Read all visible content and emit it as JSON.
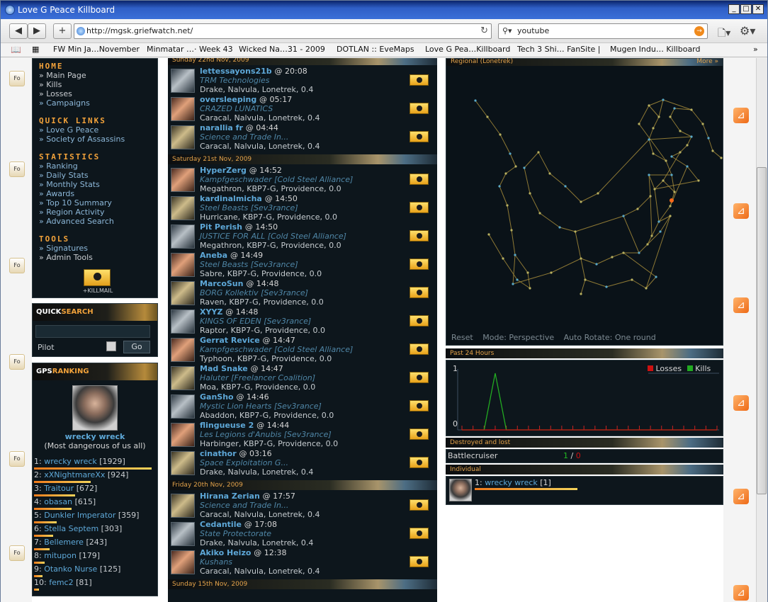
{
  "window": {
    "title": "Love G Peace Killboard"
  },
  "browser": {
    "url": "http://mgsk.griefwatch.net/",
    "search_value": "youtube",
    "bookmarks": [
      "FW Min Ja…November",
      "Minmatar …· Week 43",
      "Wicked Na…31 - 2009",
      "DOTLAN :: EveMaps",
      "Love G Pea…Killboard",
      "Tech 3 Shi… FanSite |",
      "Mugen Indu… Killboard"
    ]
  },
  "nav": {
    "home_title": "HOME",
    "home_links": [
      "Main Page",
      "Kills",
      "Losses",
      "Campaigns"
    ],
    "quick_title": "QUICK LINKS",
    "quick_links": [
      "Love G Peace",
      "Society of Assassins"
    ],
    "stats_title": "STATISTICS",
    "stats_links": [
      "Ranking",
      "Daily Stats",
      "Monthly Stats",
      "Awards",
      "Top 10 Summary",
      "Region Activity",
      "Advanced Search"
    ],
    "tools_title": "TOOLS",
    "tools_links": [
      "Signatures",
      "Admin Tools"
    ],
    "killmail_label": "+KILLMAIL"
  },
  "quicksearch": {
    "title_a": "QUICK",
    "title_b": "SEARCH",
    "field_label": "Pilot",
    "go": "Go"
  },
  "gpsranking": {
    "title_a": "GPS",
    "title_b": "RANKING",
    "top_name": "wrecky wreck",
    "top_sub": "(Most dangerous of us all)",
    "rows": [
      {
        "rank": "1:",
        "name": "wrecky wreck",
        "score": "[1929]",
        "bar": 1.0
      },
      {
        "rank": "2:",
        "name": "xXNightmareXx",
        "score": "[924]",
        "bar": 0.48
      },
      {
        "rank": "3:",
        "name": "Traitour",
        "score": "[672]",
        "bar": 0.35
      },
      {
        "rank": "4:",
        "name": "obasan",
        "score": "[615]",
        "bar": 0.32
      },
      {
        "rank": "5:",
        "name": "Dunkler Imperator",
        "score": "[359]",
        "bar": 0.19
      },
      {
        "rank": "6:",
        "name": "Stella Septem",
        "score": "[303]",
        "bar": 0.16
      },
      {
        "rank": "7:",
        "name": "Bellemere",
        "score": "[243]",
        "bar": 0.13
      },
      {
        "rank": "8:",
        "name": "mitupon",
        "score": "[179]",
        "bar": 0.09
      },
      {
        "rank": "9:",
        "name": "Otanko Nurse",
        "score": "[125]",
        "bar": 0.07
      },
      {
        "rank": "10:",
        "name": "femc2",
        "score": "[81]",
        "bar": 0.04
      }
    ]
  },
  "days": [
    {
      "label": "Sunday 22nd Nov, 2009",
      "kills": [
        {
          "pilot": "lettessayons21b",
          "time": "@ 20:08",
          "corp": "TRM Technologies",
          "alliance": "",
          "loc": "Drake, Nalvula, Lonetrek, 0.4"
        },
        {
          "pilot": "oversleeping",
          "time": "@ 05:17",
          "corp": "CRAZED LUNATICS",
          "alliance": "",
          "loc": "Caracal, Nalvula, Lonetrek, 0.4"
        },
        {
          "pilot": "narallia fr",
          "time": "@ 04:44",
          "corp": "Science and Trade In...",
          "alliance": "",
          "loc": "Caracal, Nalvula, Lonetrek, 0.4"
        }
      ]
    },
    {
      "label": "Saturday 21st Nov, 2009",
      "kills": [
        {
          "pilot": "HyperZerg",
          "time": "@ 14:52",
          "corp": "Kampfgeschwader",
          "alliance": "[Cold Steel Alliance]",
          "loc": "Megathron, KBP7-G, Providence, 0.0"
        },
        {
          "pilot": "kardinalmicha",
          "time": "@ 14:50",
          "corp": "Steel Beasts",
          "alliance": "[Sev3rance]",
          "loc": "Hurricane, KBP7-G, Providence, 0.0"
        },
        {
          "pilot": "Pit Perish",
          "time": "@ 14:50",
          "corp": "JUSTICE FOR ALL",
          "alliance": "[Cold Steel Alliance]",
          "loc": "Megathron, KBP7-G, Providence, 0.0"
        },
        {
          "pilot": "Aneba",
          "time": "@ 14:49",
          "corp": "Steel Beasts",
          "alliance": "[Sev3rance]",
          "loc": "Sabre, KBP7-G, Providence, 0.0"
        },
        {
          "pilot": "MarcoSun",
          "time": "@ 14:48",
          "corp": "BORG Kollektiv",
          "alliance": "[Sev3rance]",
          "loc": "Raven, KBP7-G, Providence, 0.0"
        },
        {
          "pilot": "XYYZ",
          "time": "@ 14:48",
          "corp": "KINGS OF EDEN",
          "alliance": "[Sev3rance]",
          "loc": "Raptor, KBP7-G, Providence, 0.0"
        },
        {
          "pilot": "Gerrat Revice",
          "time": "@ 14:47",
          "corp": "Kampfgeschwader",
          "alliance": "[Cold Steel Alliance]",
          "loc": "Typhoon, KBP7-G, Providence, 0.0"
        },
        {
          "pilot": "Mad Snake",
          "time": "@ 14:47",
          "corp": "Haluter",
          "alliance": "[Freelancer Coalition]",
          "loc": "Moa, KBP7-G, Providence, 0.0"
        },
        {
          "pilot": "GanSho",
          "time": "@ 14:46",
          "corp": "Mystic Lion Hearts",
          "alliance": "[Sev3rance]",
          "loc": "Abaddon, KBP7-G, Providence, 0.0"
        },
        {
          "pilot": "flingueuse 2",
          "time": "@ 14:44",
          "corp": "Les Legions d'Anubis",
          "alliance": "[Sev3rance]",
          "loc": "Harbinger, KBP7-G, Providence, 0.0"
        },
        {
          "pilot": "cinathor",
          "time": "@ 03:16",
          "corp": "Space Exploitation G...",
          "alliance": "",
          "loc": "Drake, Nalvula, Lonetrek, 0.4"
        }
      ]
    },
    {
      "label": "Friday 20th Nov, 2009",
      "kills": [
        {
          "pilot": "Hirana Zerian",
          "time": "@ 17:57",
          "corp": "Science and Trade In...",
          "alliance": "",
          "loc": "Caracal, Nalvula, Lonetrek, 0.4"
        },
        {
          "pilot": "Cedantile",
          "time": "@ 17:08",
          "corp": "State Protectorate",
          "alliance": "",
          "loc": "Drake, Nalvula, Lonetrek, 0.4"
        },
        {
          "pilot": "Akiko Heizo",
          "time": "@ 12:38",
          "corp": "Kushans",
          "alliance": "",
          "loc": "Caracal, Nalvula, Lonetrek, 0.4"
        }
      ]
    },
    {
      "label": "Sunday 15th Nov, 2009",
      "kills": []
    }
  ],
  "map": {
    "header": "Regional (Lonetrek)",
    "more": "More »",
    "controls": [
      "Reset",
      "Mode: Perspective",
      "Auto Rotate: One round"
    ]
  },
  "past24": {
    "header": "Past 24 Hours",
    "legend_losses": "Losses",
    "legend_kills": "Kills",
    "y_max_label": "1",
    "y_min_label": "0",
    "colors": {
      "losses": "#cc1111",
      "kills": "#22aa22"
    }
  },
  "chart_data": {
    "type": "line",
    "title": "Past 24 Hours",
    "xlabel": "",
    "ylabel": "",
    "ylim": [
      0,
      1
    ],
    "x": [
      0,
      1,
      2,
      3,
      4,
      5,
      6,
      7,
      8,
      9,
      10,
      11,
      12,
      13,
      14,
      15,
      16,
      17,
      18,
      19,
      20,
      21,
      22,
      23
    ],
    "series": [
      {
        "name": "Kills",
        "values": [
          0,
          0,
          0,
          1,
          0,
          0,
          0,
          0,
          0,
          0,
          0,
          0,
          0,
          0,
          0,
          0,
          0,
          0,
          0,
          0,
          0,
          0,
          0,
          0
        ]
      },
      {
        "name": "Losses",
        "values": [
          0,
          0,
          0,
          0,
          0,
          0,
          0,
          0,
          0,
          0,
          0,
          0,
          0,
          0,
          0,
          0,
          0,
          0,
          0,
          0,
          0,
          0,
          0,
          0
        ]
      }
    ]
  },
  "destroyed": {
    "header": "Destroyed and lost",
    "class": "Battlecruiser",
    "kills": "1",
    "sep": "/",
    "losses": "0"
  },
  "individual": {
    "header": "Individual",
    "rank": "1:",
    "name": "wrecky wreck",
    "score": "[1]"
  }
}
